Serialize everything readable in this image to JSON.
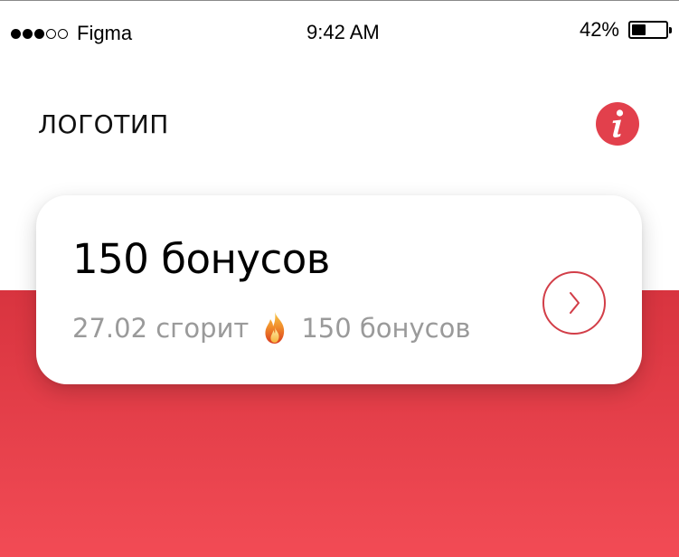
{
  "status_bar": {
    "carrier": "Figma",
    "signal_bars_filled": 3,
    "signal_bars_total": 5,
    "time": "9:42 AM",
    "battery_percent_label": "42%",
    "battery_level": 0.42
  },
  "header": {
    "logo_text": "ЛОГОТИП",
    "info_icon": "info-icon"
  },
  "bonus_card": {
    "title": "150 бонусов",
    "expire_label": "27.02 сгорит",
    "expire_icon": "fire-icon",
    "expire_amount": "150 бонусов",
    "action_icon": "chevron-right-icon"
  },
  "colors": {
    "accent": "#e2404c",
    "gradient_top": "#d8343f",
    "gradient_bottom": "#f24b55",
    "muted_text": "#9a9a9a"
  }
}
